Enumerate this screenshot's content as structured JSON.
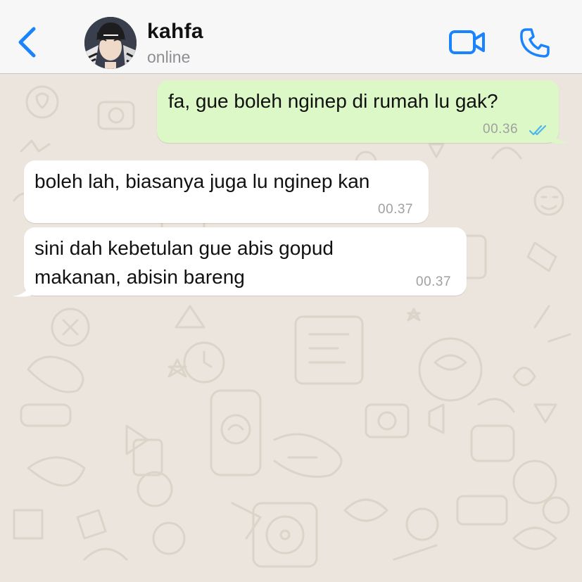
{
  "header": {
    "contact_name": "kahfa",
    "contact_status": "online",
    "back_icon": "chevron-left-icon",
    "video_icon": "video-camera-icon",
    "call_icon": "phone-icon",
    "accent_color": "#1a84ff"
  },
  "messages": [
    {
      "direction": "outgoing",
      "text": "fa, gue boleh nginep di rumah lu gak?",
      "time": "00.36",
      "status": "read"
    },
    {
      "direction": "incoming",
      "text": "boleh lah, biasanya juga lu nginep kan",
      "time": "00.37"
    },
    {
      "direction": "incoming",
      "text": "sini dah kebetulan gue abis gopud\nmakanan, abisin bareng",
      "time": "00.37"
    }
  ],
  "colors": {
    "outgoing_bubble": "#dcf8c6",
    "incoming_bubble": "#ffffff",
    "chat_background": "#ece5dd",
    "read_ticks": "#4fb6ec"
  }
}
